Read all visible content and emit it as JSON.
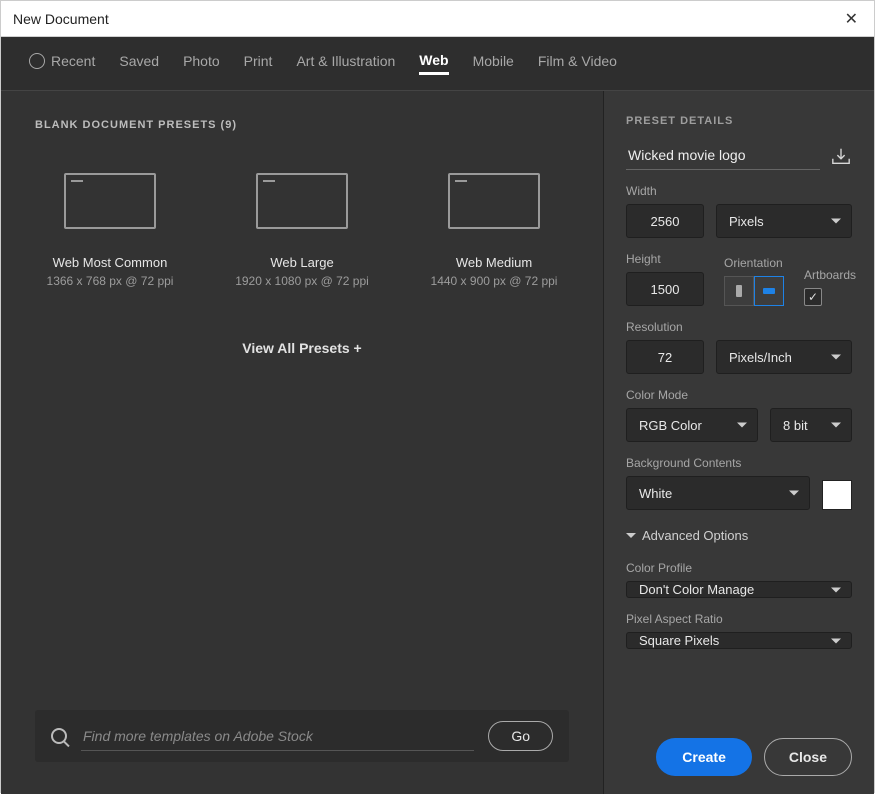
{
  "window": {
    "title": "New Document"
  },
  "tabs": {
    "recent": "Recent",
    "saved": "Saved",
    "photo": "Photo",
    "print": "Print",
    "art": "Art & Illustration",
    "web": "Web",
    "mobile": "Mobile",
    "film": "Film & Video"
  },
  "presets_header": "BLANK DOCUMENT PRESETS (9)",
  "presets": [
    {
      "name": "Web Most Common",
      "desc": "1366 x 768 px @ 72 ppi"
    },
    {
      "name": "Web Large",
      "desc": "1920 x 1080 px @ 72 ppi"
    },
    {
      "name": "Web Medium",
      "desc": "1440 x 900 px @ 72 ppi"
    }
  ],
  "view_all": "View All Presets +",
  "search": {
    "placeholder": "Find more templates on Adobe Stock",
    "go": "Go"
  },
  "details": {
    "header": "PRESET DETAILS",
    "name": "Wicked movie logo",
    "width_label": "Width",
    "width": "2560",
    "width_unit": "Pixels",
    "height_label": "Height",
    "height": "1500",
    "orientation_label": "Orientation",
    "artboards_label": "Artboards",
    "artboards_checked": "✓",
    "resolution_label": "Resolution",
    "resolution": "72",
    "resolution_unit": "Pixels/Inch",
    "color_mode_label": "Color Mode",
    "color_mode": "RGB Color",
    "color_depth": "8 bit",
    "bg_label": "Background Contents",
    "bg": "White",
    "advanced": "Advanced Options",
    "profile_label": "Color Profile",
    "profile": "Don't Color Manage",
    "pixel_ar_label": "Pixel Aspect Ratio",
    "pixel_ar": "Square Pixels"
  },
  "buttons": {
    "create": "Create",
    "close": "Close"
  }
}
